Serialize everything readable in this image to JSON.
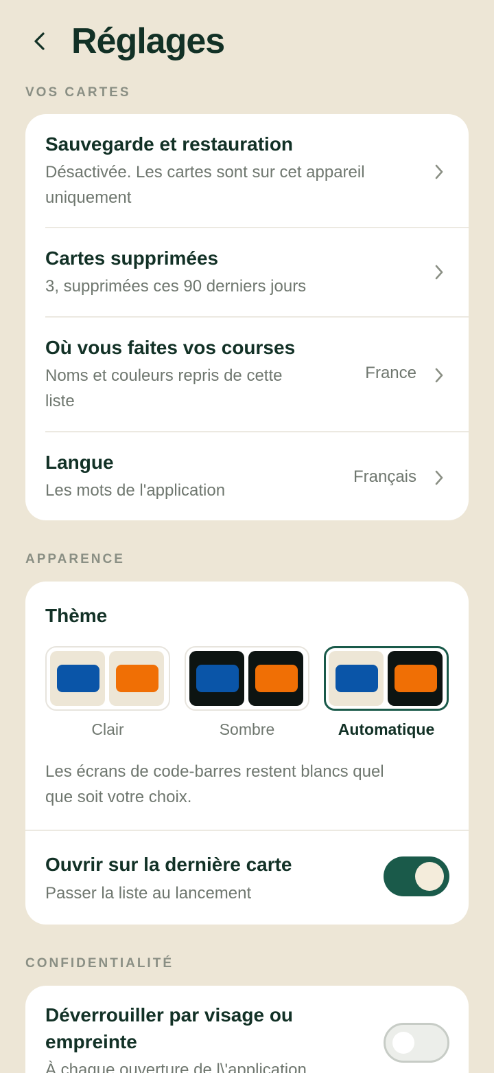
{
  "header": {
    "title": "Réglages"
  },
  "sections": {
    "cards": "VOS CARTES",
    "appearance": "APPARENCE",
    "privacy": "CONFIDENTIALITÉ"
  },
  "cards_rows": [
    {
      "title": "Sauvegarde et restauration",
      "sub1": "Désactivée. Les cartes sont sur cet appareil",
      "sub2": "uniquement",
      "value": ""
    },
    {
      "title": "Cartes supprimées",
      "sub1": "3, supprimées ces 90 derniers jours",
      "sub2": "",
      "value": ""
    },
    {
      "title": "Où vous faites vos courses",
      "sub1": "Noms et couleurs repris de cette",
      "sub2": "liste",
      "value": "France"
    },
    {
      "title": "Langue",
      "sub1": "Les mots de l'application",
      "sub2": "",
      "value": "Français"
    }
  ],
  "appearance": {
    "theme_title": "Thème",
    "options": [
      {
        "label": "Clair",
        "selected": false
      },
      {
        "label": "Sombre",
        "selected": false
      },
      {
        "label": "Automatique",
        "selected": true
      }
    ],
    "note1": "Les écrans de code-barres restent blancs quel",
    "note2": "que soit votre choix.",
    "open_last": {
      "title": "Ouvrir sur la dernière carte",
      "sub": "Passer la liste au lancement",
      "enabled": true
    }
  },
  "privacy": {
    "unlock": {
      "title1": "Déverrouiller par visage ou",
      "title2": "empreinte",
      "sub": "À chaque ouverture de l\\'application",
      "enabled": false
    }
  },
  "colors": {
    "background": "#ede6d6",
    "primary": "#1a5a4a",
    "blue": "#0a55a8",
    "orange": "#f06f05",
    "dark": "#0d1412",
    "cream": "#ede6d6"
  }
}
